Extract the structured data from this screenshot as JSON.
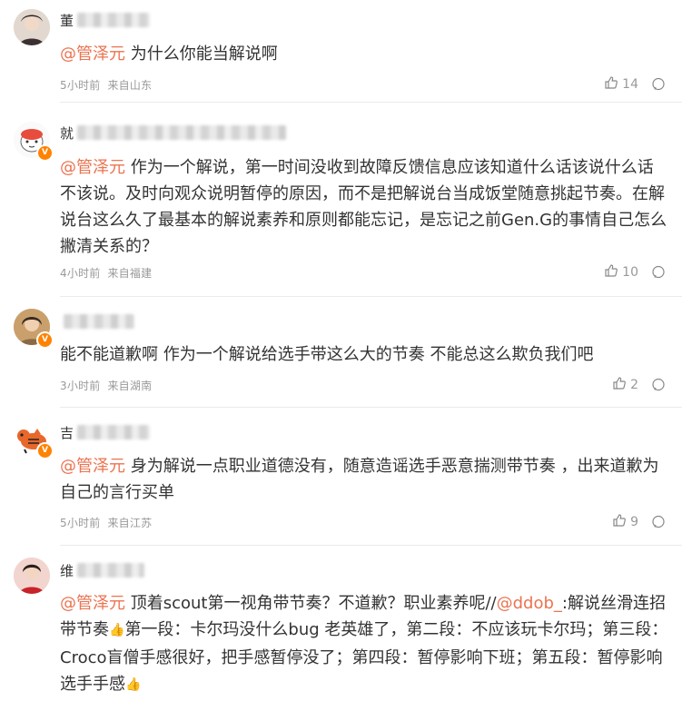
{
  "comments": [
    {
      "name_initial": "董",
      "mention": "@管泽元",
      "text": " 为什么你能当解说啊",
      "time": "5小时前",
      "location": "来自山东",
      "likes": "14"
    },
    {
      "name_initial": "就",
      "verified": true,
      "mention": "@管泽元",
      "text": " 作为一个解说，第一时间没收到故障反馈信息应该知道什么话该说什么话不该说。及时向观众说明暂停的原因，而不是把解说台当成饭堂随意挑起节奏。在解说台这么久了最基本的解说素养和原则都能忘记，是忘记之前Gen.G的事情自己怎么撇清关系的？",
      "time": "4小时前",
      "location": "来自福建",
      "likes": "10"
    },
    {
      "name_initial": "",
      "verified": true,
      "mention": "",
      "text": "能不能道歉啊 作为一个解说给选手带这么大的节奏 不能总这么欺负我们吧",
      "time": "3小时前",
      "location": "来自湖南",
      "likes": "2"
    },
    {
      "name_initial": "吉",
      "verified": true,
      "mention": "@管泽元",
      "text": " 身为解说一点职业道德没有，随意造谣选手恶意揣测带节奏 ，出来道歉为自己的言行买单",
      "time": "5小时前",
      "location": "来自江苏",
      "likes": "9"
    },
    {
      "name_initial": "维",
      "mention": "@管泽元",
      "text_parts": [
        " 顶着scout第一视角带节奏？不道歉？职业素养呢//",
        "@ddob_",
        ":解说丝滑连招带节奏",
        "第一段：卡尔玛没什么bug 老英雄了，第二段：不应该玩卡尔玛；第三段：Croco盲僧手感很好，把手感暂停没了；第四段：暂停影响下班；第五段：暂停影响选手手感"
      ],
      "emoji": "👍"
    }
  ]
}
